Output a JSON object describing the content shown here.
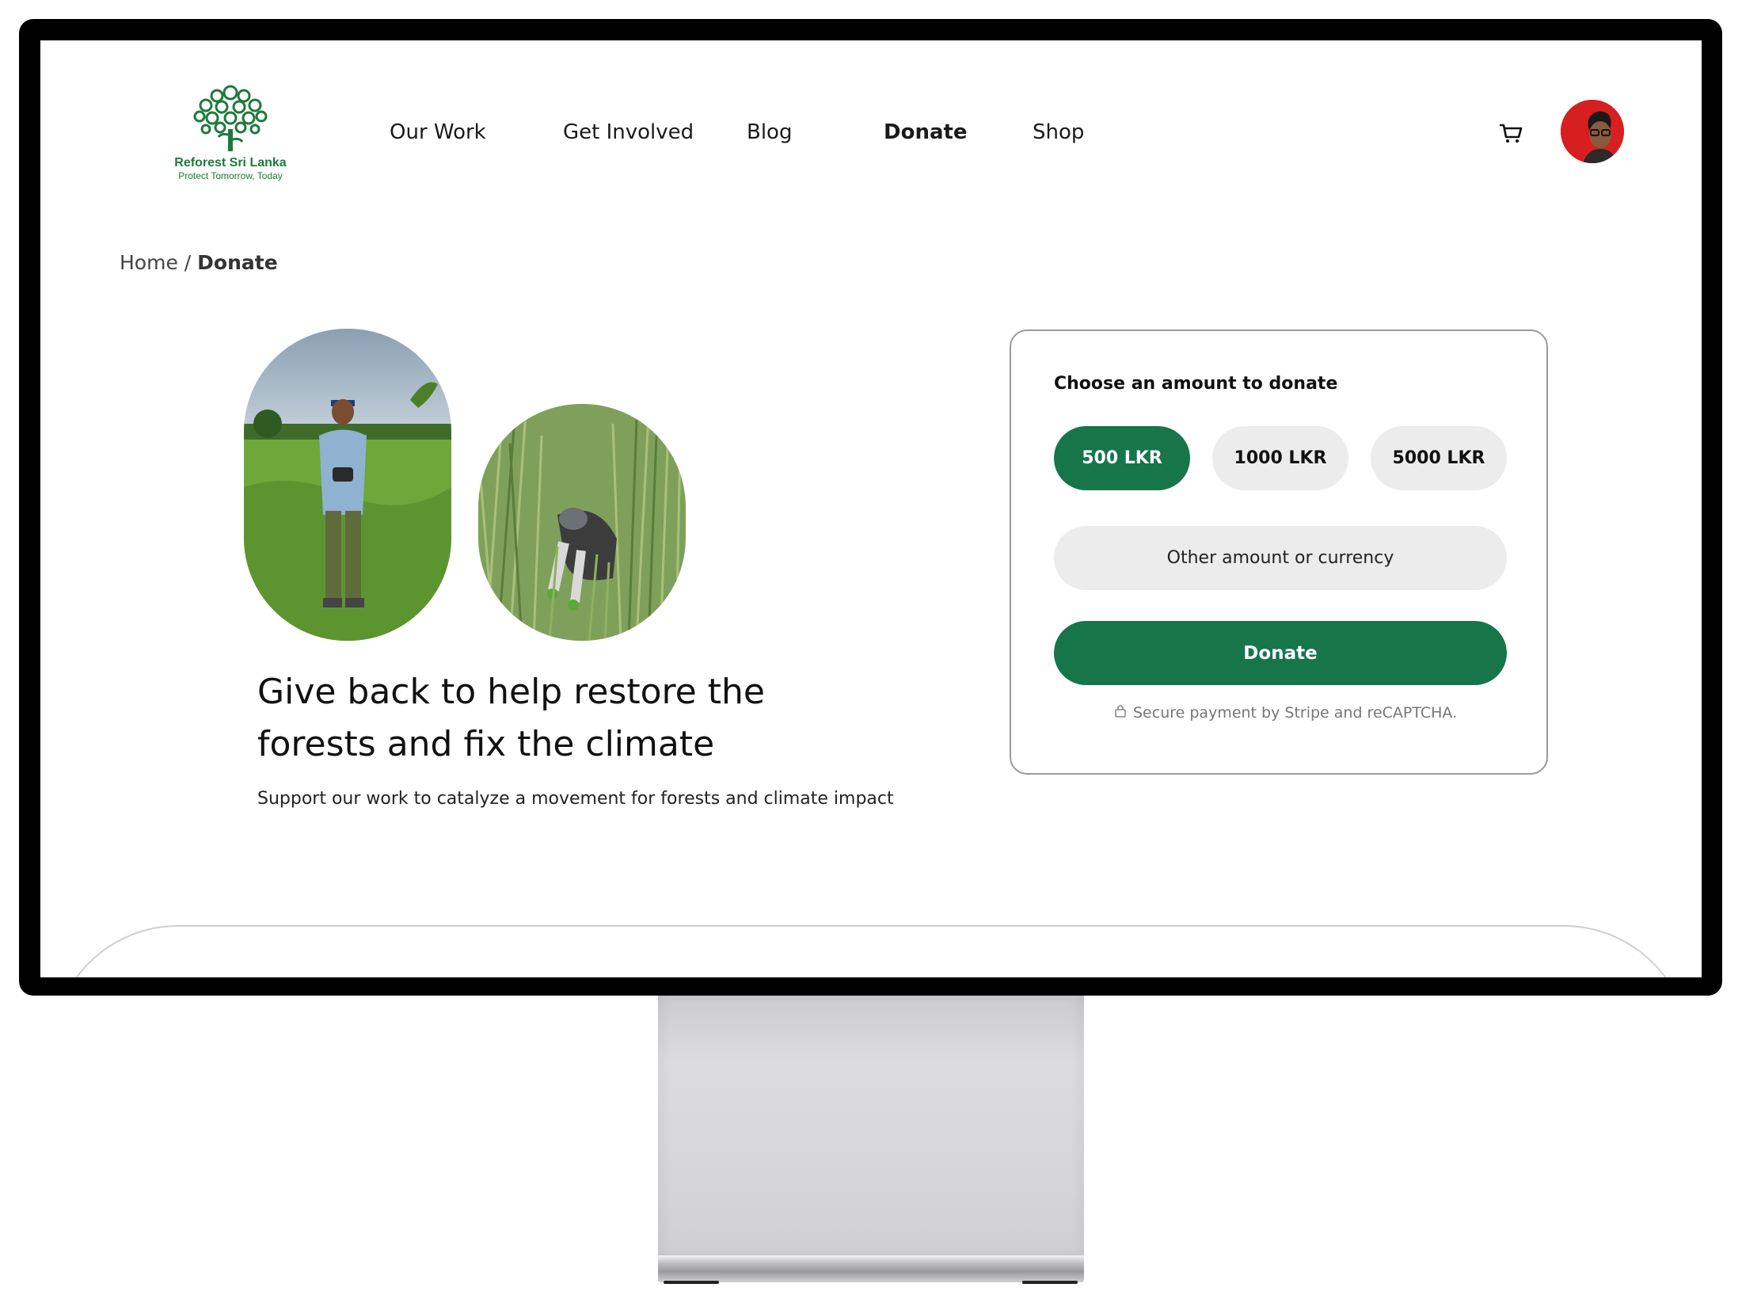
{
  "brand": {
    "name": "Reforest Sri Lanka",
    "tagline": "Protect Tomorrow, Today",
    "color": "#1e7a3c"
  },
  "nav": {
    "items": [
      {
        "label": "Our Work",
        "active": false
      },
      {
        "label": "Get Involved",
        "active": false
      },
      {
        "label": "Blog",
        "active": false
      },
      {
        "label": "Donate",
        "active": true
      },
      {
        "label": "Shop",
        "active": false
      }
    ],
    "cart_icon": "cart-icon",
    "avatar_icon": "user-avatar"
  },
  "breadcrumb": {
    "home": "Home",
    "separator": "/",
    "current": "Donate"
  },
  "hero": {
    "headline": "Give back to help restore the forests and fix the climate",
    "subtext": "Support our work to catalyze a movement for forests and climate impact"
  },
  "donate_card": {
    "title": "Choose an amount to donate",
    "amounts": [
      "500 LKR",
      "1000 LKR",
      "5000 LKR"
    ],
    "selected_amount": "500 LKR",
    "other_label": "Other amount or currency",
    "donate_label": "Donate",
    "secure_note": "Secure payment by Stripe and reCAPTCHA.",
    "lock_icon": "lock-icon"
  },
  "colors": {
    "accent": "#17754a",
    "chip_bg": "#ececec",
    "avatar_bg": "#d71f1f"
  }
}
